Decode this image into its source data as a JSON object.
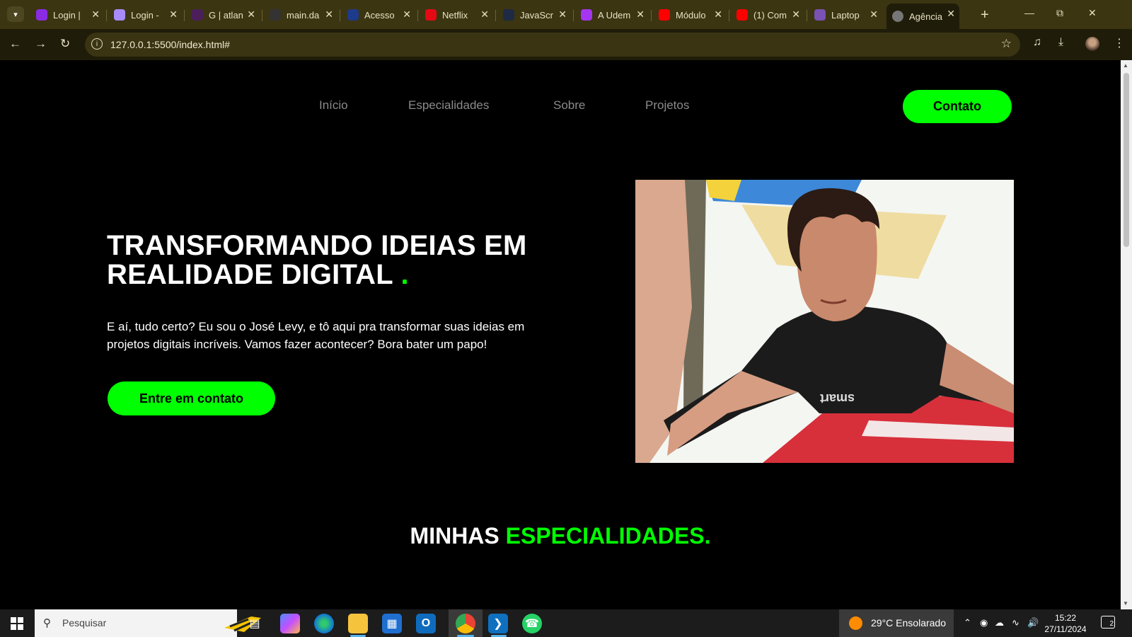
{
  "browser": {
    "tabs": [
      {
        "title": "Login |",
        "icon": "purple-logo-icon",
        "color": "#8a2be2"
      },
      {
        "title": "Login -",
        "icon": "feather-logo-icon",
        "color": "#a78bfa"
      },
      {
        "title": "G | atlan",
        "icon": "atlan-logo-icon",
        "color": "#4b1f5a"
      },
      {
        "title": "main.da",
        "icon": "github-icon",
        "color": "#333333"
      },
      {
        "title": "Acesso",
        "icon": "dots-logo-icon",
        "color": "#1e3a8a"
      },
      {
        "title": "Netflix",
        "icon": "netflix-icon",
        "color": "#e50914"
      },
      {
        "title": "JavaScr",
        "icon": "code-logo-icon",
        "color": "#1f2a44"
      },
      {
        "title": "A Udem",
        "icon": "udemy-icon",
        "color": "#a435f0"
      },
      {
        "title": "Módulo",
        "icon": "youtube-icon",
        "color": "#ff0000"
      },
      {
        "title": "(1) Com",
        "icon": "youtube-icon",
        "color": "#ff0000"
      },
      {
        "title": "Laptop",
        "icon": "bootstrap-icon",
        "color": "#7952b3"
      },
      {
        "title": "Agência",
        "icon": "globe-icon",
        "color": "#767676"
      }
    ],
    "url": "127.0.0.1:5500/index.html#"
  },
  "nav": {
    "links": [
      "Início",
      "Especialidades",
      "Sobre",
      "Projetos"
    ],
    "contact": "Contato"
  },
  "hero": {
    "title_line1": "TRANSFORMANDO IDEIAS EM",
    "title_line2": "REALIDADE DIGITAL",
    "title_dot": ".",
    "text": "E aí, tudo certo? Eu sou o José Levy, e tô aqui pra transformar suas ideias em projetos digitais incríveis. Vamos fazer acontecer? Bora bater um papo!",
    "button": "Entre em contato",
    "photo_shirt_text": "smart"
  },
  "section": {
    "title_white": "MINHAS",
    "title_green": "ESPECIALIDADES."
  },
  "taskbar": {
    "search_placeholder": "Pesquisar",
    "weather": "29°C  Ensolarado",
    "time": "15:22",
    "date": "27/11/2024",
    "notifications": "2"
  },
  "colors": {
    "accent": "#00ff00",
    "background": "#000000",
    "nav_text": "#8b8b8b",
    "chrome": "#3b3512"
  }
}
